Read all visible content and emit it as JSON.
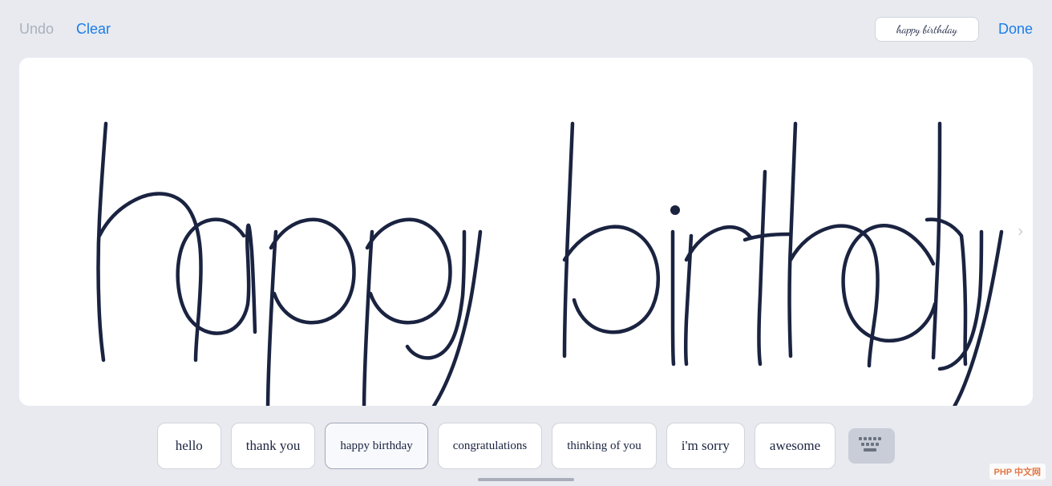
{
  "toolbar": {
    "undo_label": "Undo",
    "clear_label": "Clear",
    "done_label": "Done",
    "preview_text": "happy birthday"
  },
  "canvas": {
    "handwriting_text": "happy birthday"
  },
  "suggestions": {
    "items": [
      {
        "id": "hello",
        "label": "hello"
      },
      {
        "id": "thank-you",
        "label": "thank you"
      },
      {
        "id": "happy-birthday",
        "label": "happy birthday"
      },
      {
        "id": "congratulations",
        "label": "congratulations"
      },
      {
        "id": "thinking-of-you",
        "label": "thinking of you"
      },
      {
        "id": "im-sorry",
        "label": "i'm sorry"
      },
      {
        "id": "awesome",
        "label": "awesome"
      }
    ],
    "keyboard_icon_label": "keyboard"
  },
  "watermark": {
    "text": "PHP 中文网"
  },
  "colors": {
    "background": "#e8eaf0",
    "accent": "#1a7de8",
    "ink": "#1a2340",
    "muted": "#aab0bc"
  }
}
